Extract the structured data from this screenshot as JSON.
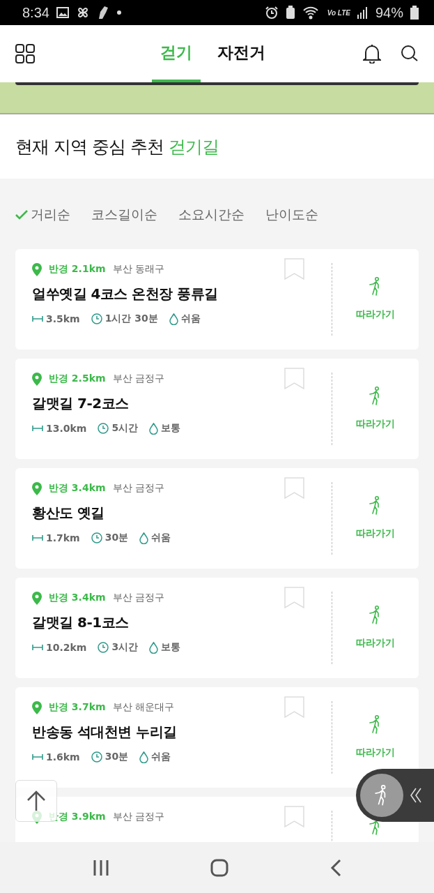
{
  "status_bar": {
    "time": "8:34",
    "network": "Vo LTE",
    "battery": "94%"
  },
  "header": {
    "tabs": [
      {
        "label": "걷기",
        "selected": true
      },
      {
        "label": "자전거",
        "selected": false
      }
    ]
  },
  "section": {
    "title": "현재 지역 중심 추천 **걷기길**"
  },
  "sort_options": [
    {
      "label": "거리순",
      "selected": true
    },
    {
      "label": "코스길이순",
      "selected": false
    },
    {
      "label": "소요시간순",
      "selected": false
    },
    {
      "label": "난이도순",
      "selected": false
    }
  ],
  "courses": [
    {
      "radius": "반경 2.1km",
      "region": "부산 동래구",
      "name": "얼쑤옛길 4코스 온천장 풍류길",
      "distance": "3.5km",
      "time": "1시간 30분",
      "difficulty": "쉬움",
      "follow": "따라가기"
    },
    {
      "radius": "반경 2.5km",
      "region": "부산 금정구",
      "name": "갈맷길 7-2코스",
      "distance": "13.0km",
      "time": "5시간",
      "difficulty": "보통",
      "follow": "따라가기"
    },
    {
      "radius": "반경 3.4km",
      "region": "부산 금정구",
      "name": "황산도 옛길",
      "distance": "1.7km",
      "time": "30분",
      "difficulty": "쉬움",
      "follow": "따라가기"
    },
    {
      "radius": "반경 3.4km",
      "region": "부산 금정구",
      "name": "갈맷길 8-1코스",
      "distance": "10.2km",
      "time": "3시간",
      "difficulty": "보통",
      "follow": "따라가기"
    },
    {
      "radius": "반경 3.7km",
      "region": "부산 해운대구",
      "name": "반송동 석대천변 누리길",
      "distance": "1.6km",
      "time": "30분",
      "difficulty": "쉬움",
      "follow": "따라가기"
    },
    {
      "radius": "반경 3.9km",
      "region": "부산 금정구"
    }
  ]
}
